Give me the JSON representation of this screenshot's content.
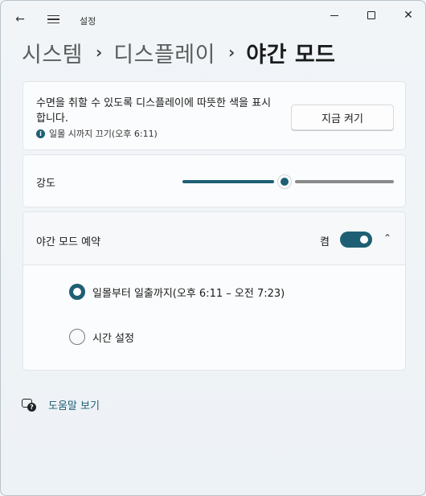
{
  "window": {
    "app_title": "설정",
    "controls": {
      "back_icon": "←",
      "close_icon": "✕"
    }
  },
  "breadcrumb": {
    "items": [
      "시스템",
      "디스플레이",
      "야간 모드"
    ],
    "separator": "›"
  },
  "night_light_card": {
    "description": "수면을 취할 수 있도록 디스플레이에 따뜻한 색을 표시합니다.",
    "info_text": "일몰 시까지 끄기(오후 6:11)",
    "info_icon_glyph": "i",
    "button_label": "지금 켜기"
  },
  "strength": {
    "label": "강도",
    "value_fraction": 0.48
  },
  "schedule": {
    "label": "야간 모드 예약",
    "toggle_state_text": "켬",
    "toggle_on": true,
    "chevron_glyph": "⌃",
    "options": [
      {
        "label": "일몰부터 일출까지(오후 6:11 – 오전 7:23)",
        "selected": true
      },
      {
        "label": "시간 설정",
        "selected": false
      }
    ]
  },
  "help": {
    "label": "도움말 보기",
    "icon_glyph": "?"
  },
  "colors": {
    "accent": "#1e5f74",
    "background": "#eef3f6",
    "card": "#fbfcfd"
  }
}
